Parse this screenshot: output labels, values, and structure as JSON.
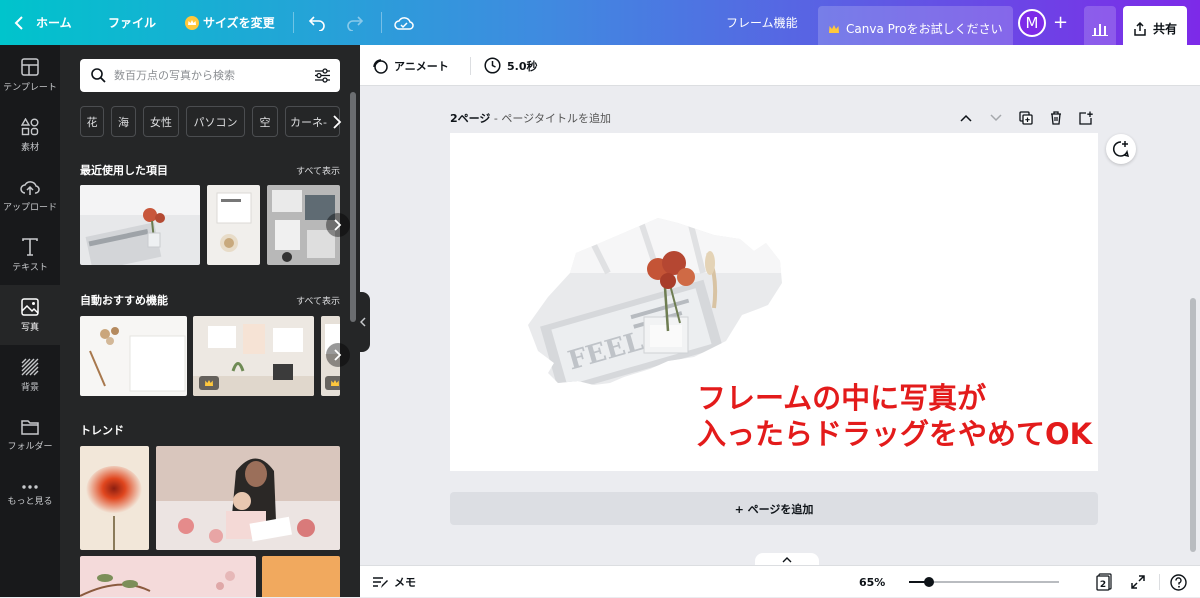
{
  "topbar": {
    "home": "ホーム",
    "file": "ファイル",
    "resize": "サイズを変更",
    "frame_feature": "フレーム機能",
    "pro_trial": "Canva Proをお試しください",
    "avatar_letter": "M",
    "share": "共有"
  },
  "rail": {
    "items": [
      {
        "label": "テンプレート",
        "icon": "template-icon"
      },
      {
        "label": "素材",
        "icon": "elements-icon"
      },
      {
        "label": "アップロード",
        "icon": "upload-icon"
      },
      {
        "label": "テキスト",
        "icon": "text-icon"
      },
      {
        "label": "写真",
        "icon": "photo-icon"
      },
      {
        "label": "背景",
        "icon": "background-icon"
      },
      {
        "label": "フォルダー",
        "icon": "folder-icon"
      },
      {
        "label": "もっと見る",
        "icon": "more-icon"
      }
    ],
    "active_index": 4
  },
  "panel": {
    "search_placeholder": "数百万点の写真から検索",
    "chips": [
      "花",
      "海",
      "女性",
      "パソコン",
      "空",
      "カーネ-"
    ],
    "recent_title": "最近使用した項目",
    "see_all": "すべて表示",
    "auto_title": "自動おすすめ機能",
    "trend_title": "トレンド"
  },
  "toolbar": {
    "animate": "アニメート",
    "duration": "5.0秒"
  },
  "page": {
    "label_bold": "2ページ",
    "label_rest": " - ページタイトルを追加"
  },
  "canvas": {
    "caption_line1": "フレームの中に写真が",
    "caption_line2": "入ったらドラッグをやめてOK"
  },
  "add_page": "+ ページを追加",
  "footer": {
    "notes": "メモ",
    "zoom": "65%",
    "zoom_level": 0.13,
    "page_count": "2"
  },
  "colors": {
    "accent": "#7d2ae8",
    "teal": "#00c4cc",
    "caption": "#e31b1b",
    "panel_bg": "#252627",
    "rail_bg": "#18191b"
  }
}
